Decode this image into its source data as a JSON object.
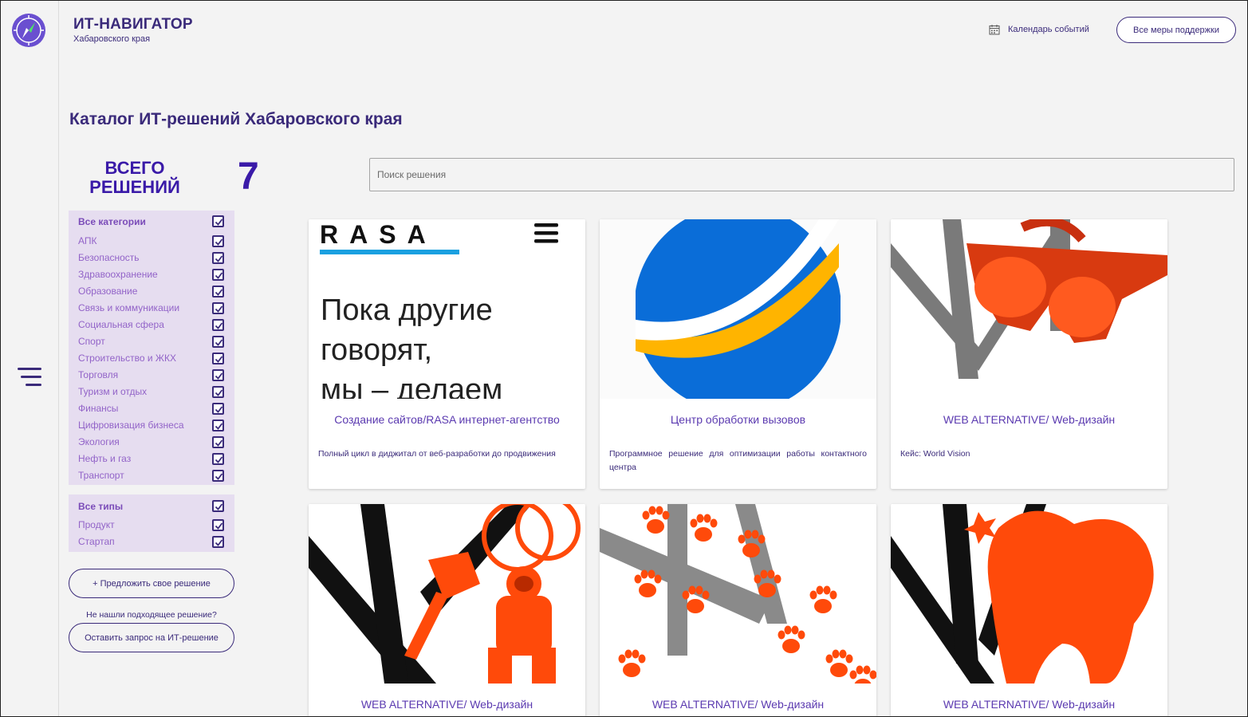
{
  "brand": {
    "title": "ИТ-НАВИГАТОР",
    "subtitle": "Хабаровского края"
  },
  "header": {
    "calendar_label": "Календарь событий",
    "support_button": "Все меры поддержки"
  },
  "page_title": "Каталог ИТ-решений Хабаровского края",
  "total": {
    "label_line1": "ВСЕГО",
    "label_line2": "РЕШЕНИЙ",
    "count": "7"
  },
  "search": {
    "placeholder": "Поиск решения"
  },
  "categories": {
    "all_label": "Все категории",
    "items": [
      "АПК",
      "Безопасность",
      "Здравоохранение",
      "Образование",
      "Связь и коммуникации",
      "Социальная сфера",
      "Спорт",
      "Строительство и ЖКХ",
      "Торговля",
      "Туризм и отдых",
      "Финансы",
      "Цифровизация бизнеса",
      "Экология",
      "Нефть и газ",
      "Транспорт"
    ]
  },
  "types": {
    "all_label": "Все типы",
    "items": [
      "Продукт",
      "Стартап"
    ]
  },
  "actions": {
    "propose_button": "+ Предложить свое решение",
    "not_found_hint": "Не нашли подходящее решение?",
    "request_button": "Оставить запрос на ИТ-решение"
  },
  "cards": [
    {
      "title": "Создание сайтов/RASA интернет-агентство",
      "desc": "Полный цикл в диджитал от веб-разработки до продвижения",
      "logo_text": "RASA",
      "img_text_1": "Пока другие",
      "img_text_2": "говорят,",
      "img_text_3": "мы – делаем"
    },
    {
      "title": "Центр обработки вызовов",
      "desc": "Программное решение для оптимизации работы контактного центра"
    },
    {
      "title": "WEB ALTERNATIVE/ Web-дизайн",
      "desc": "Кейс: World Vision"
    },
    {
      "title": "WEB ALTERNATIVE/ Web-дизайн",
      "desc": ""
    },
    {
      "title": "WEB ALTERNATIVE/ Web-дизайн",
      "desc": ""
    },
    {
      "title": "WEB ALTERNATIVE/ Web-дизайн",
      "desc": ""
    }
  ],
  "colors": {
    "primary": "#3a2a7a",
    "accent": "#3a1aa8",
    "filter_bg": "#e6ddf0",
    "filter_text": "#9263c8",
    "orange": "#ff4a0a"
  }
}
